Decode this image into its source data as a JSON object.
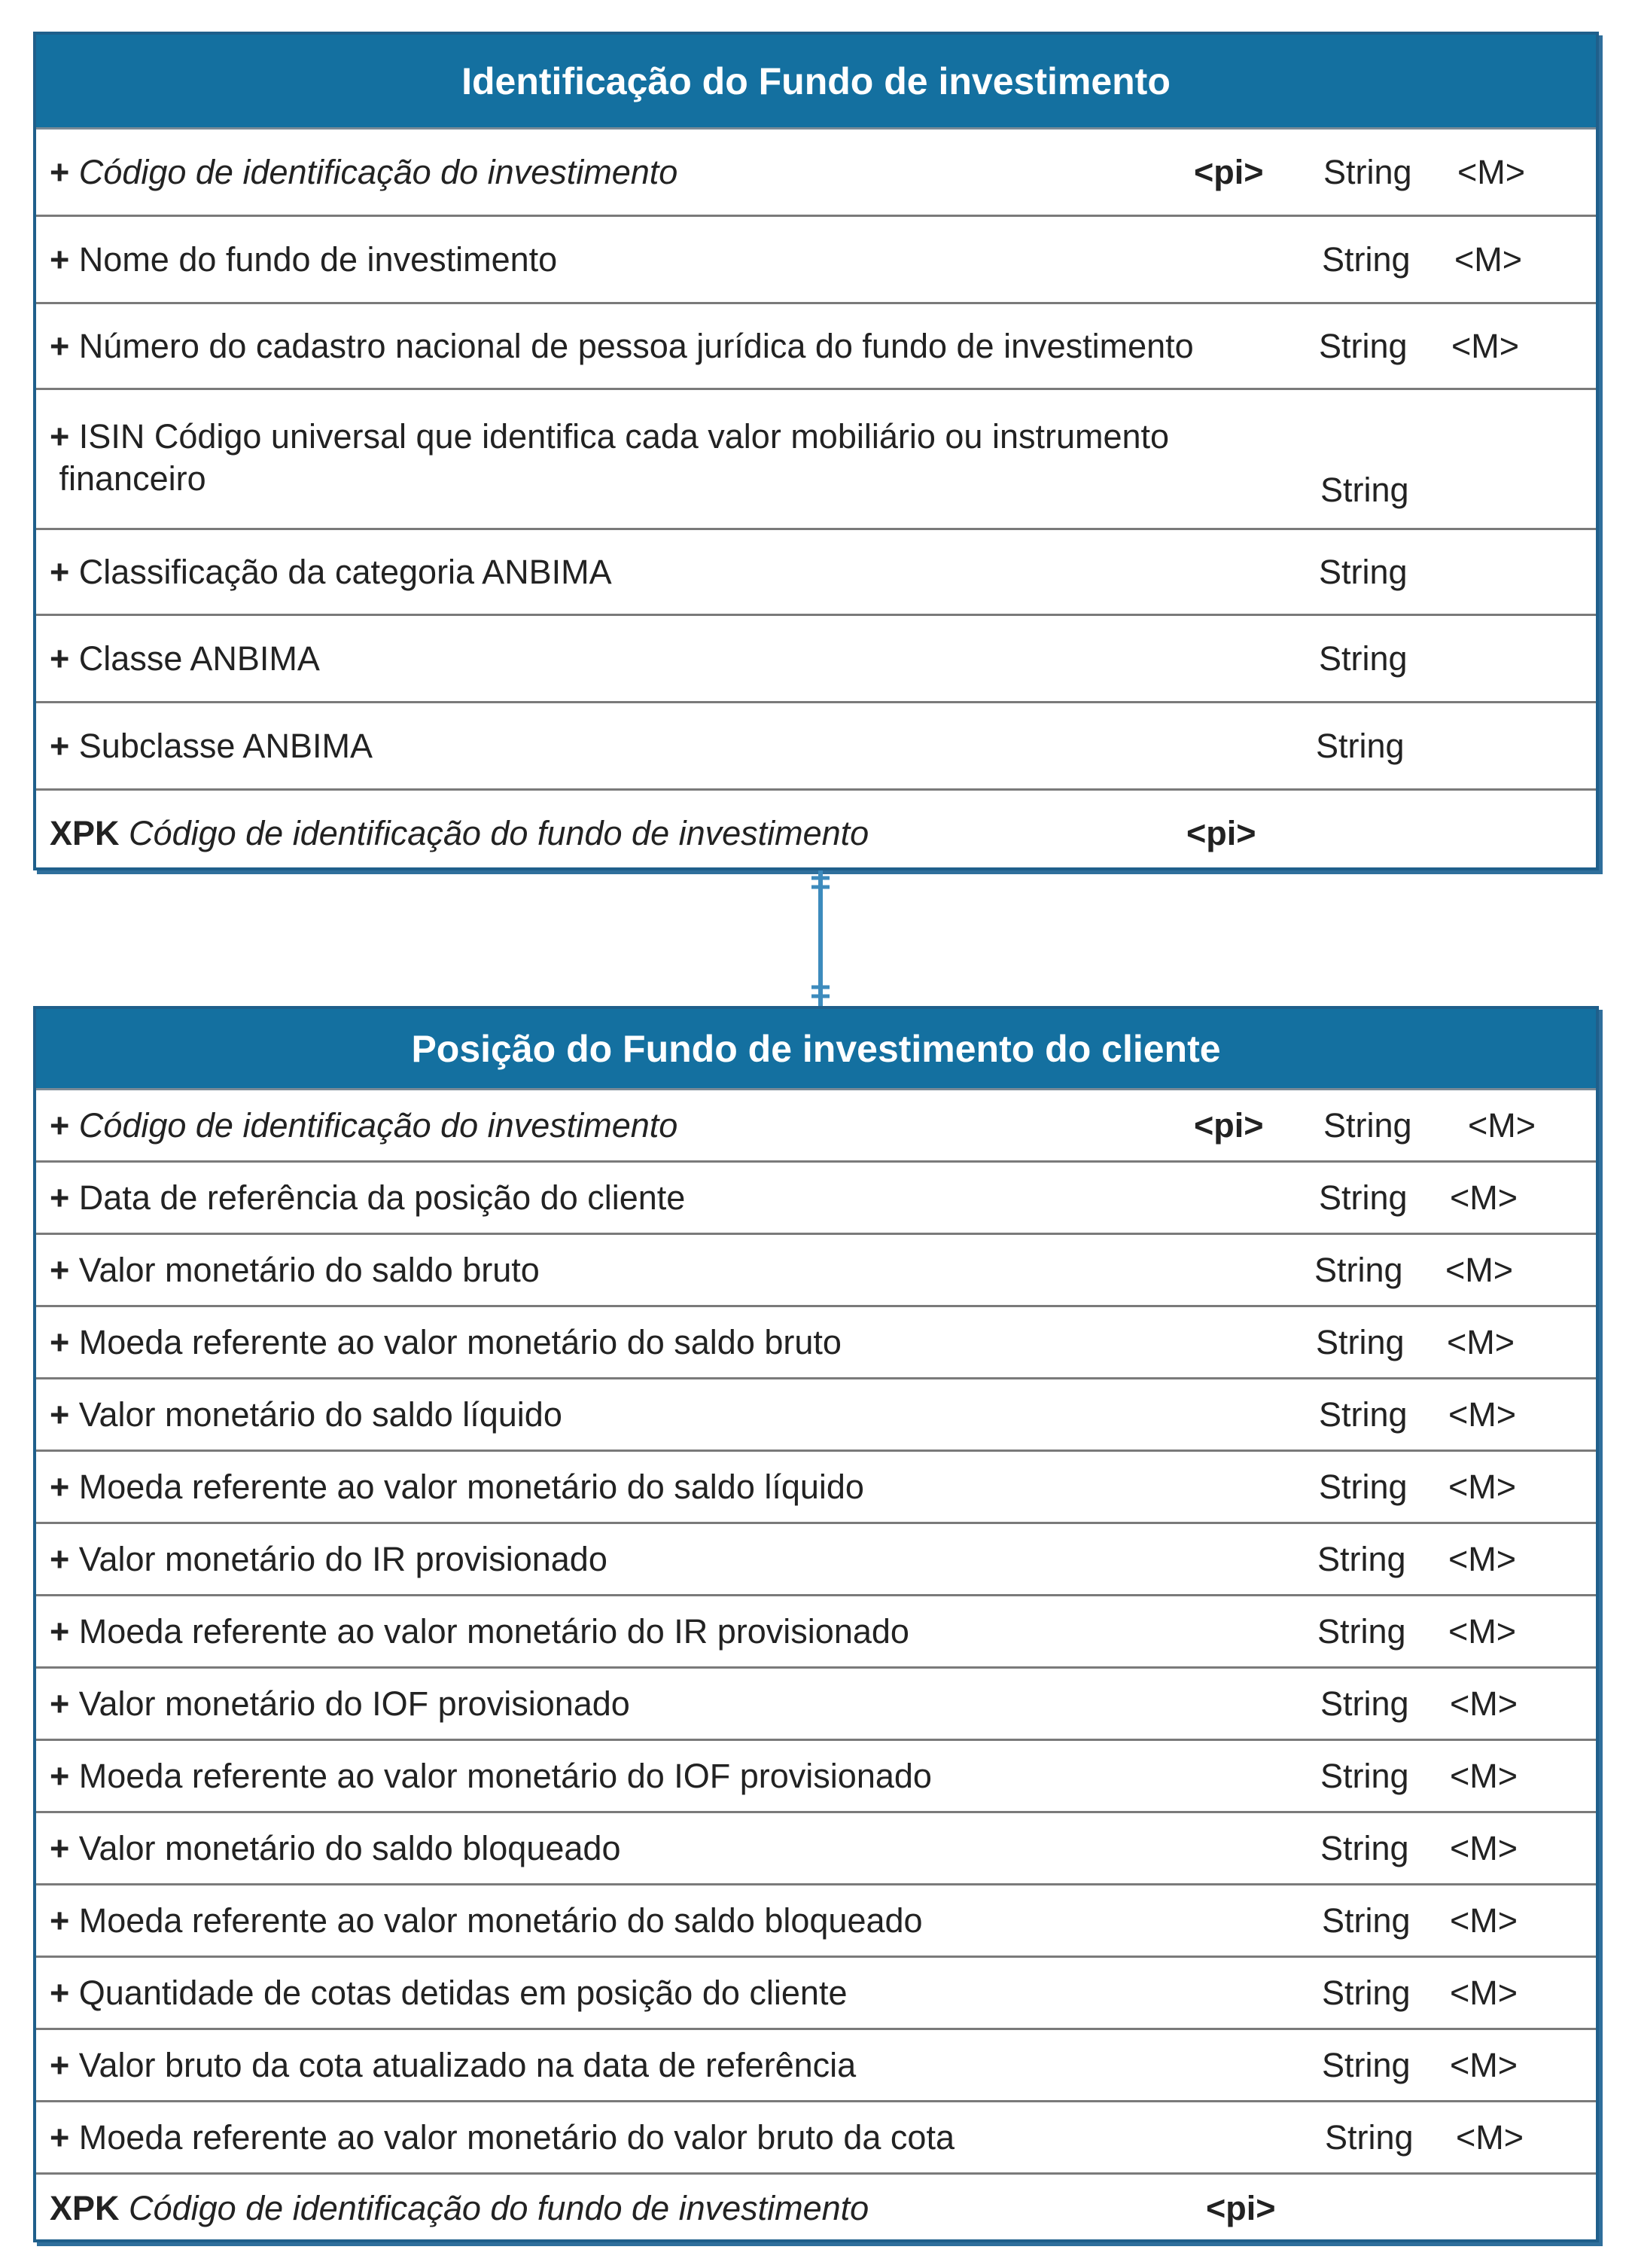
{
  "entities": [
    {
      "title": "Identificação do Fundo de investimento",
      "rows": [
        {
          "prefix": "+",
          "label": "Código de identificação do investimento",
          "italic": true,
          "pi": "<pi>",
          "type": "String",
          "mand": "<M>"
        },
        {
          "prefix": "+",
          "label": "Nome do fundo de investimento",
          "type": "String",
          "mand": "<M>"
        },
        {
          "prefix": "+",
          "label": "Número do cadastro nacional de pessoa jurídica do fundo de investimento",
          "type": "String",
          "mand": "<M>"
        },
        {
          "prefix": "+",
          "label": "ISIN Código universal que identifica cada valor mobiliário ou instrumento\n financeiro",
          "type": "String"
        },
        {
          "prefix": "+",
          "label": "Classificação da categoria ANBIMA",
          "type": "String"
        },
        {
          "prefix": "+",
          "label": "Classe ANBIMA",
          "type": "String"
        },
        {
          "prefix": "+",
          "label": "Subclasse ANBIMA",
          "type": "String"
        },
        {
          "prefix": "XPK",
          "label": "Código de identificação do fundo de investimento",
          "italic": true,
          "pi": "<pi>"
        }
      ]
    },
    {
      "title": "Posição do Fundo de investimento do cliente",
      "rows": [
        {
          "prefix": "+",
          "label": "Código de identificação do investimento",
          "italic": true,
          "pi": "<pi>",
          "type": "String",
          "mand": "<M>"
        },
        {
          "prefix": "+",
          "label": "Data de referência da posição do cliente",
          "type": "String",
          "mand": "<M>"
        },
        {
          "prefix": "+",
          "label": "Valor monetário do saldo bruto",
          "type": "String",
          "mand": "<M>"
        },
        {
          "prefix": "+",
          "label": "Moeda referente ao valor monetário do saldo bruto",
          "type": "String",
          "mand": "<M>"
        },
        {
          "prefix": "+",
          "label": "Valor monetário do saldo líquido",
          "type": "String",
          "mand": "<M>"
        },
        {
          "prefix": "+",
          "label": "Moeda referente ao valor monetário do saldo líquido",
          "type": "String",
          "mand": "<M>"
        },
        {
          "prefix": "+",
          "label": "Valor monetário do IR provisionado",
          "type": "String",
          "mand": "<M>"
        },
        {
          "prefix": "+",
          "label": "Moeda referente ao valor monetário do IR provisionado",
          "type": "String",
          "mand": "<M>"
        },
        {
          "prefix": "+",
          "label": "Valor monetário do IOF provisionado",
          "type": "String",
          "mand": "<M>"
        },
        {
          "prefix": "+",
          "label": "Moeda referente ao valor monetário do IOF provisionado",
          "type": "String",
          "mand": "<M>"
        },
        {
          "prefix": "+",
          "label": "Valor monetário do saldo bloqueado",
          "type": "String",
          "mand": "<M>"
        },
        {
          "prefix": "+",
          "label": "Moeda referente ao valor monetário do saldo bloqueado",
          "type": "String",
          "mand": "<M>"
        },
        {
          "prefix": "+",
          "label": "Quantidade de cotas detidas em posição do cliente",
          "type": "String",
          "mand": "<M>"
        },
        {
          "prefix": "+",
          "label": "Valor bruto da cota atualizado na data de referência",
          "type": "String",
          "mand": "<M>"
        },
        {
          "prefix": "+",
          "label": "Moeda referente ao valor monetário do valor bruto da cota",
          "type": "String",
          "mand": "<M>"
        },
        {
          "prefix": "XPK",
          "label": "Código de identificação do fundo de investimento",
          "italic": true,
          "pi": "<pi>"
        }
      ]
    }
  ],
  "colors": {
    "header_bg": "#1470a0",
    "header_text": "#ffffff",
    "border": "#1f5f8b",
    "connector": "#3d8bbd"
  }
}
